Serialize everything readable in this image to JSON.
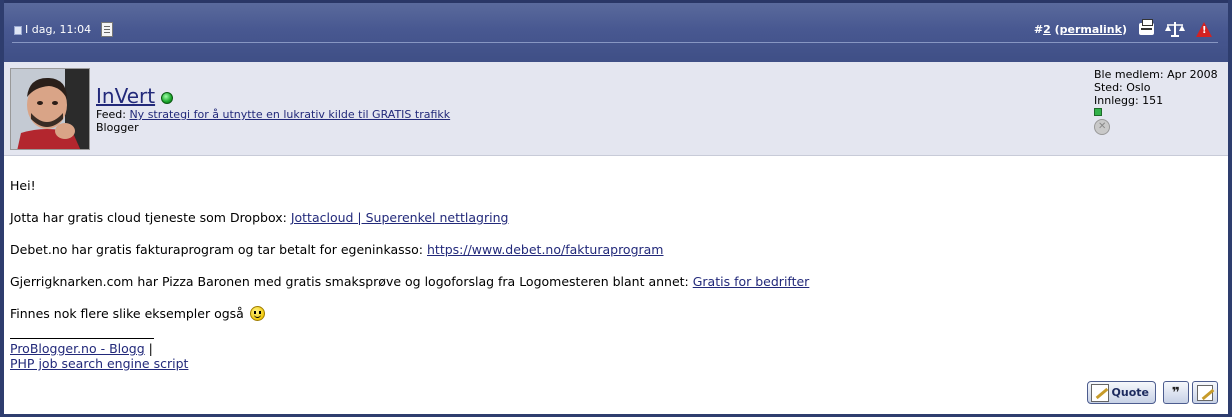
{
  "header": {
    "date": "I dag, 11:04",
    "post_number_prefix": "#",
    "post_number": "2",
    "permalink_label": "permalink"
  },
  "user": {
    "name": "InVert",
    "feed_label": "Feed:",
    "feed_link": "Ny strategi for å utnytte en lukrativ kilde til GRATIS trafikk",
    "title": "Blogger",
    "joined": "Ble medlem: Apr 2008",
    "location": "Sted: Oslo",
    "posts": "Innlegg: 151"
  },
  "message": {
    "line1": "Hei!",
    "line2_text": "Jotta har gratis cloud tjeneste som Dropbox: ",
    "line2_link": "Jottacloud | Superenkel nettlagring",
    "line3_text": "Debet.no har gratis fakturaprogram og tar betalt for egeninkasso: ",
    "line3_link": "https://www.debet.no/fakturaprogram",
    "line4_text": "Gjerrigknarken.com har Pizza Baronen med gratis smaksprøve og logoforslag fra Logomesteren blant annet: ",
    "line4_link": "Gratis for bedrifter",
    "line5_text": "Finnes nok flere slike eksempler også "
  },
  "signature": {
    "link1": "ProBlogger.no - Blogg",
    "separator": " |",
    "link2": "PHP job search engine script"
  },
  "actions": {
    "quote_label": "Quote"
  },
  "colors": {
    "header_bg": "#485891",
    "userbar_bg": "#e4e6f0",
    "link": "#22297a",
    "report": "#d32222"
  },
  "icons": [
    "post-icon",
    "document-icon",
    "printer-icon",
    "scales-icon",
    "warning-icon",
    "online-status-icon",
    "reputation-icon",
    "offline-icon",
    "smiley-icon",
    "quote-icon",
    "multiquote-icon",
    "quick-reply-icon"
  ]
}
